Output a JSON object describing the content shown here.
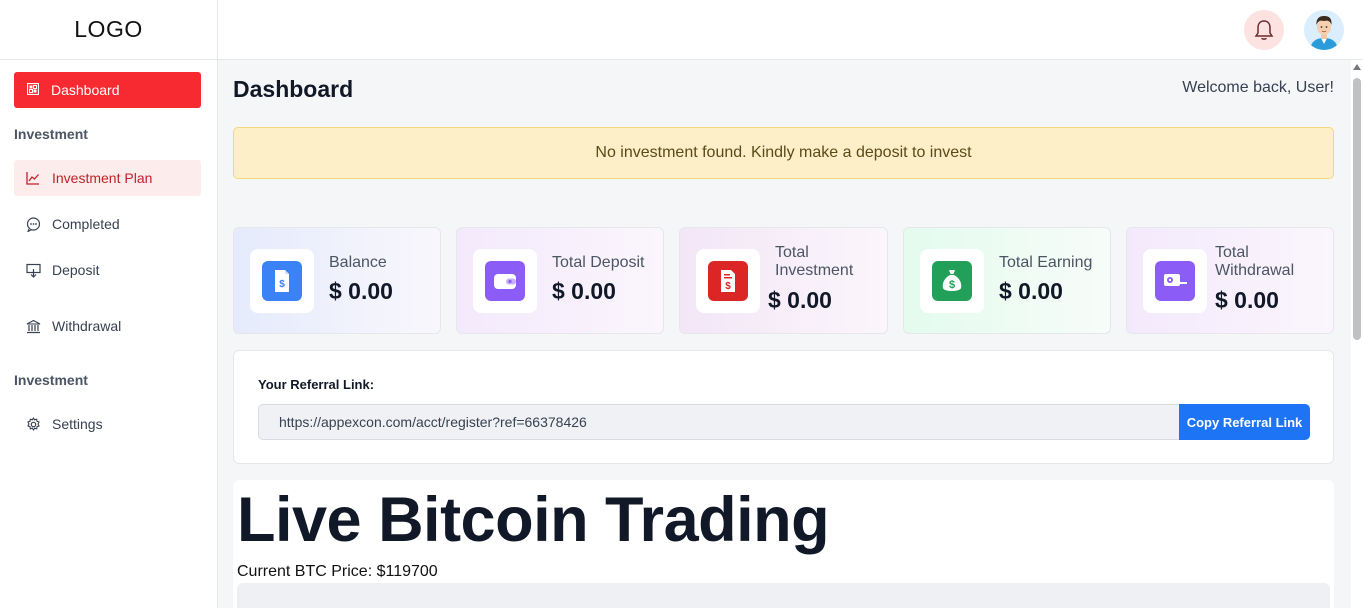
{
  "logo": "LOGO",
  "sidebar": {
    "active": {
      "label": "Dashboard",
      "icon": "dashboard-icon"
    },
    "sections": [
      {
        "label": "Investment"
      },
      {
        "label": "Investment"
      }
    ],
    "items": [
      {
        "label": "Investment Plan",
        "icon": "chart-line-icon"
      },
      {
        "label": "Completed",
        "icon": "chat-bubble-icon"
      },
      {
        "label": "Deposit",
        "icon": "deposit-icon"
      },
      {
        "label": "Withdrawal",
        "icon": "bank-icon"
      },
      {
        "label": "Settings",
        "icon": "gear-icon"
      }
    ]
  },
  "header": {
    "icons": [
      "bell-icon",
      "user-avatar"
    ]
  },
  "main": {
    "title": "Dashboard",
    "welcome": "Welcome back, User!",
    "alert": "No investment found. Kindly make a deposit to invest",
    "cards": [
      {
        "label": "Balance",
        "value": "$ 0.00",
        "icon": "document-dollar-icon",
        "color": "#3b82f6"
      },
      {
        "label": "Total Deposit",
        "value": "$ 0.00",
        "icon": "wallet-icon",
        "color": "#8b5cf6"
      },
      {
        "label": "Total Investment",
        "value": "$ 0.00",
        "icon": "invoice-dollar-icon",
        "color": "#dc2626"
      },
      {
        "label": "Total Earning",
        "value": "$ 0.00",
        "icon": "money-bag-icon",
        "color": "#22a05a"
      },
      {
        "label": "Total Withdrawal",
        "value": "$ 0.00",
        "icon": "cash-icon",
        "color": "#8b5cf6"
      }
    ],
    "referral": {
      "label": "Your Referral Link:",
      "link": "https://appexcon.com/acct/register?ref=66378426",
      "button": "Copy Referral Link"
    },
    "btc": {
      "title": "Live Bitcoin Trading",
      "price_text": "Current BTC Price: $119700"
    }
  },
  "colors": {
    "accent": "#f72931",
    "primary_button": "#1d74f5",
    "alert_bg": "#fdf0c8"
  }
}
